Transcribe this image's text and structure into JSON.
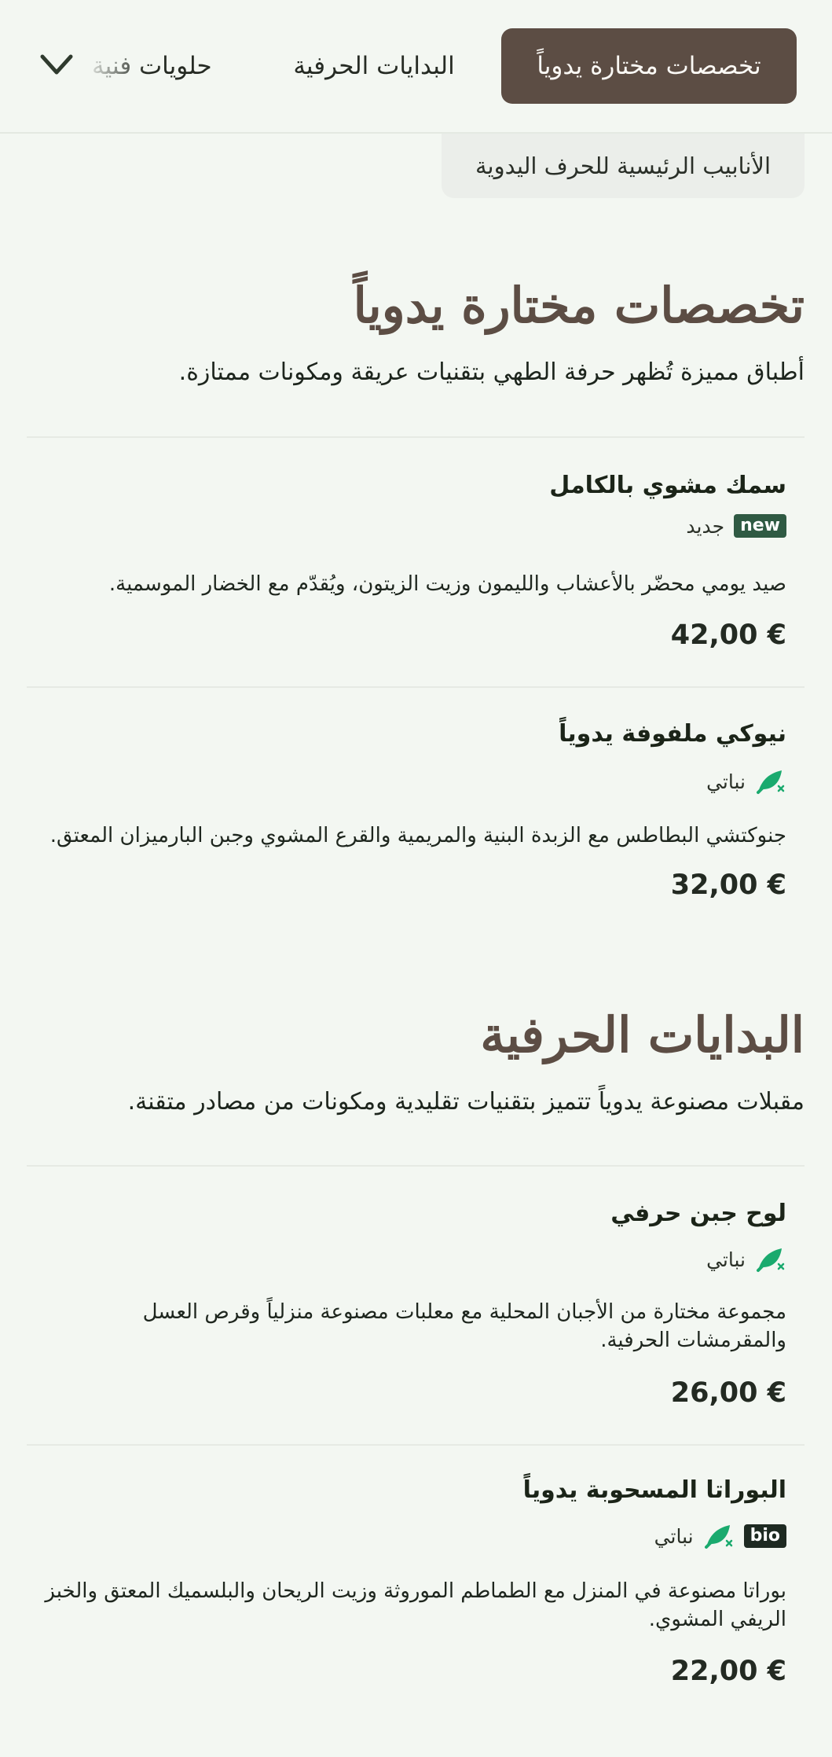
{
  "nav": {
    "tabs": [
      {
        "label": "تخصصات مختارة يدوياً",
        "active": true
      },
      {
        "label": "البدايات الحرفية",
        "active": false
      },
      {
        "label": "حلويات فنية",
        "active": false
      }
    ],
    "more_icon": "chevron-down-icon",
    "subtab_label": "الأنابيب الرئيسية للحرف اليدوية"
  },
  "colors": {
    "accent": "#5c4d44",
    "background": "#f3f7f2",
    "vegan_green": "#1aaa6e"
  },
  "sections": [
    {
      "title": "تخصصات مختارة يدوياً",
      "description": "أطباق مميزة تُظهر حرفة الطهي بتقنيات عريقة ومكونات ممتازة.",
      "items": [
        {
          "name": "سمك مشوي بالكامل",
          "tag_badge": "new",
          "tag_text": "جديد",
          "description": "صيد يومي محضّر بالأعشاب والليمون وزيت الزيتون، ويُقدّم مع الخضار الموسمية.",
          "price": "42,00 €"
        },
        {
          "name": "نيوكي ملفوفة يدوياً",
          "tag_icon": "vegan-leaf-icon",
          "tag_text": "نباتي",
          "description": "جنوكتشي البطاطس مع الزبدة البنية والمريمية والقرع المشوي وجبن البارميزان المعتق.",
          "price": "32,00 €"
        }
      ]
    },
    {
      "title": "البدايات الحرفية",
      "description": "مقبلات مصنوعة يدوياً تتميز بتقنيات تقليدية ومكونات من مصادر متقنة.",
      "items": [
        {
          "name": "لوح جبن حرفي",
          "tag_icon": "vegan-leaf-icon",
          "tag_text": "نباتي",
          "description": "مجموعة مختارة من الأجبان المحلية مع معلبات مصنوعة منزلياً وقرص العسل والمقرمشات الحرفية.",
          "price": "26,00 €"
        },
        {
          "name": "البوراتا المسحوبة يدوياً",
          "tag_badge": "bio",
          "tag_icon": "vegan-leaf-icon",
          "tag_text": "نباتي",
          "description": "بوراتا مصنوعة في المنزل مع الطماطم الموروثة وزيت الريحان والبلسميك المعتق والخبز الريفي المشوي.",
          "price": "22,00 €"
        }
      ]
    }
  ]
}
